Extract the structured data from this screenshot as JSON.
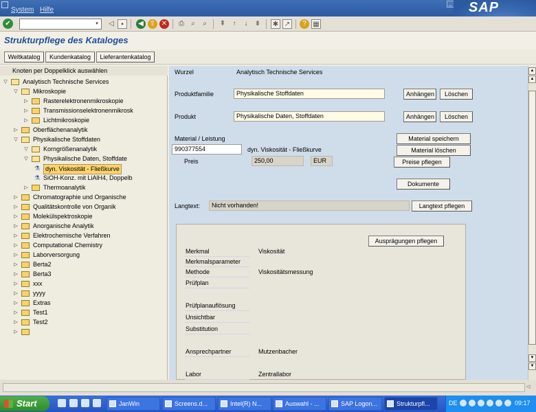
{
  "menu": {
    "items": [
      "System",
      "Hilfe"
    ],
    "logo": "SAP"
  },
  "toolbar": {
    "command_value": ""
  },
  "title": "Strukturpflege des Kataloges",
  "app_buttons": [
    "Weltkatalog",
    "Kundenkatalog",
    "Lieferantenkatalog"
  ],
  "tree": {
    "header": "Knoten per Doppelklick auswählen",
    "nodes": [
      {
        "label": "Analytisch Technische Services",
        "level": 0,
        "open": true
      },
      {
        "label": "Mikroskopie",
        "level": 1,
        "open": true
      },
      {
        "label": "Rasterelektronenmikroskopie",
        "level": 2
      },
      {
        "label": "Transmissionselektronenmikrosk",
        "level": 2
      },
      {
        "label": "Lichtmikroskopie",
        "level": 2
      },
      {
        "label": "Oberflächenanalytik",
        "level": 1
      },
      {
        "label": "Physikalische Stoffdaten",
        "level": 1,
        "open": true
      },
      {
        "label": "Korngrößenanalytik",
        "level": 2,
        "open": true
      },
      {
        "label": "Physikalische Daten, Stoffdate",
        "level": 2,
        "open": true
      },
      {
        "label": "dyn. Viskosität - Fließkurve",
        "level": 3,
        "leaf": true,
        "selected": true
      },
      {
        "label": "SiOH-Konz. mit LiAlH4, Doppelb",
        "level": 3,
        "leaf": true
      },
      {
        "label": "Thermoanalytik",
        "level": 2
      },
      {
        "label": "Chromatographie und Organische",
        "level": 1
      },
      {
        "label": "Qualitätskontrolle von Organik",
        "level": 1
      },
      {
        "label": "Molekülspektroskopie",
        "level": 1
      },
      {
        "label": "Anorganische Analytik",
        "level": 1
      },
      {
        "label": "Elektrochemische Verfahren",
        "level": 1
      },
      {
        "label": "Computational Chemistry",
        "level": 1
      },
      {
        "label": "Laborversorgung",
        "level": 1
      },
      {
        "label": "Berta2",
        "level": 1
      },
      {
        "label": "Berta3",
        "level": 1
      },
      {
        "label": "xxx",
        "level": 1
      },
      {
        "label": "yyyy",
        "level": 1
      },
      {
        "label": "Extras",
        "level": 1
      },
      {
        "label": "Test1",
        "level": 1
      },
      {
        "label": "Test2",
        "level": 1
      },
      {
        "label": "",
        "level": 1
      }
    ]
  },
  "detail": {
    "wurzel_label": "Wurzel",
    "wurzel_value": "Analytisch Technische Services",
    "produktfamilie_label": "Produktfamilie",
    "produktfamilie_value": "Physikalische Stoffdaten",
    "produkt_label": "Produkt",
    "produkt_value": "Physikalische Daten, Stoffdaten",
    "btn_anhaengen": "Anhängen",
    "btn_loeschen": "Löschen",
    "material_label": "Material / Leistung",
    "material_value": "990377554",
    "material_desc": "dyn. Viskosität - Fließkurve",
    "preis_label": "Preis",
    "preis_value": "250,00",
    "currency": "EUR",
    "btn_material_speichern": "Material speichern",
    "btn_material_loeschen": "Material löschen",
    "btn_preise_pflegen": "Preise pflegen",
    "btn_dokumente": "Dokumente",
    "langtext_label": "Langtext:",
    "langtext_value": "Nicht vorhanden!",
    "btn_langtext_pflegen": "Langtext pflegen",
    "btn_auspraegungen": "Ausprägungen pflegen",
    "attributes": [
      {
        "label": "Merkmal",
        "value": "Viskosität"
      },
      {
        "label": "Merkmalsparameter",
        "value": ""
      },
      {
        "label": "Methode",
        "value": "Viskositätsmessung"
      },
      {
        "label": "Prüfplan",
        "value": ""
      },
      {
        "label": "Prüfplanauflösung",
        "value": ""
      },
      {
        "label": "Unsichtbar",
        "value": ""
      },
      {
        "label": "Substitution",
        "value": ""
      },
      {
        "label": "Ansprechpartner",
        "value": "Mutzenbacher"
      },
      {
        "label": "Labor",
        "value": "Zentrallabor"
      }
    ]
  },
  "taskbar": {
    "start": "Start",
    "tasks": [
      "JanWin",
      "Screens.d...",
      "Intel(R) N...",
      "Auswahl - ...",
      "SAP Logon...",
      "Strukturpfl..."
    ],
    "lang": "DE",
    "clock": "09:17"
  }
}
